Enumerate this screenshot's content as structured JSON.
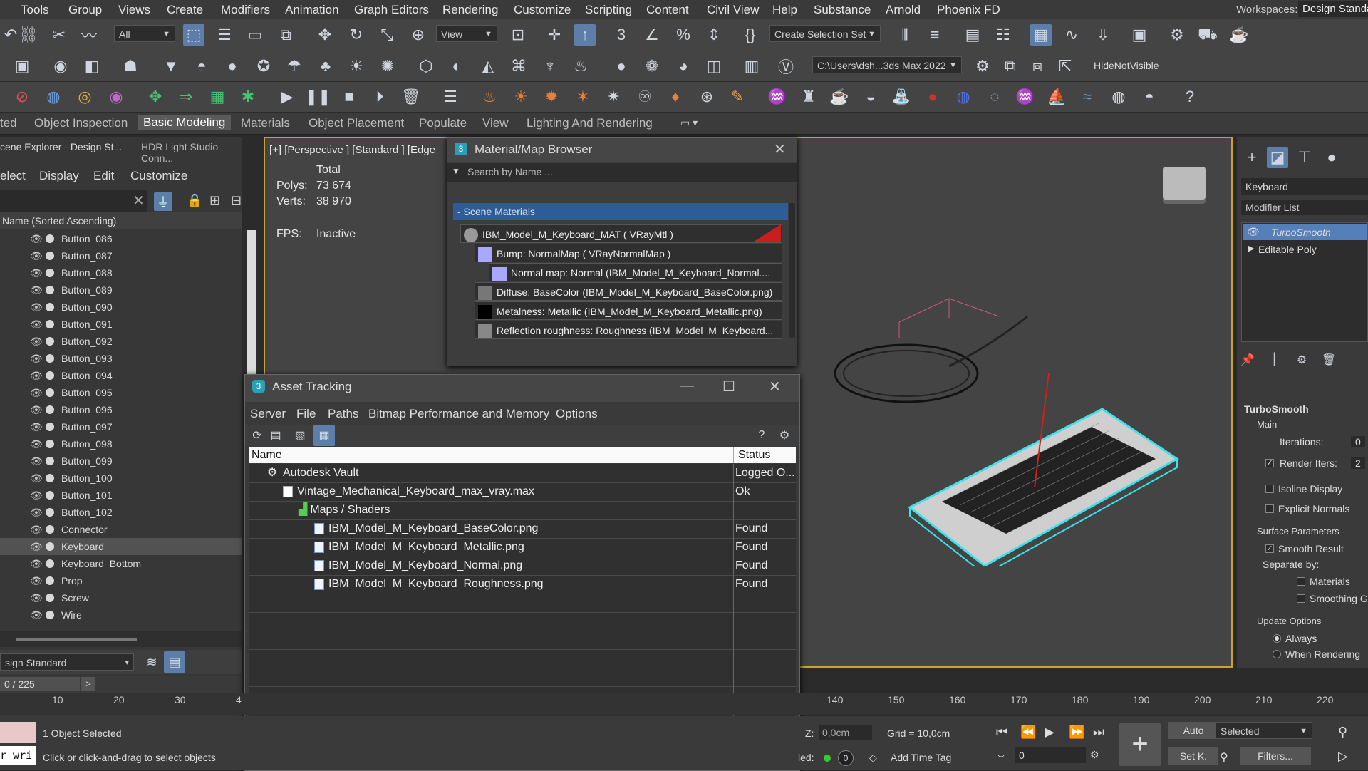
{
  "menu": [
    "Tools",
    "Group",
    "Views",
    "Create",
    "Modifiers",
    "Animation",
    "Graph Editors",
    "Rendering",
    "Customize",
    "Scripting",
    "Content",
    "Civil View",
    "Help",
    "Substance",
    "Arnold",
    "Phoenix FD"
  ],
  "workspace": {
    "label": "Workspaces:",
    "value": "Design Standard"
  },
  "toolbar": {
    "selection_filter": "All",
    "ref_coord": "View",
    "selection_set": "Create Selection Set",
    "project_path": "C:\\Users\\dsh...3ds Max 2022",
    "hide_not_visible": "HideNotVisible"
  },
  "ribbon_tabs": [
    "ted",
    "Object Inspection",
    "Basic Modeling",
    "Materials",
    "Object Placement",
    "Populate",
    "View",
    "Lighting And Rendering"
  ],
  "scene_explorer": {
    "tab1": "cene Explorer - Design St...",
    "tab2": "HDR Light Studio Conn...",
    "menu": [
      "elect",
      "Display",
      "Edit",
      "Customize"
    ],
    "column_header": "Name (Sorted Ascending)",
    "items": [
      "Button_086",
      "Button_087",
      "Button_088",
      "Button_089",
      "Button_090",
      "Button_091",
      "Button_092",
      "Button_093",
      "Button_094",
      "Button_095",
      "Button_096",
      "Button_097",
      "Button_098",
      "Button_099",
      "Button_100",
      "Button_101",
      "Button_102",
      "Connector",
      "Keyboard",
      "Keyboard_Bottom",
      "Prop",
      "Screw",
      "Wire"
    ],
    "selected": "Keyboard",
    "layer_dropdown": "sign Standard",
    "frame_counter": "0 / 225"
  },
  "viewport": {
    "label": "[+] [Perspective ] [Standard ] [Edge",
    "stats_total": "Total",
    "polys_label": "Polys:",
    "polys_value": "73 674",
    "verts_label": "Verts:",
    "verts_value": "38 970",
    "fps_label": "FPS:",
    "fps_value": "Inactive"
  },
  "material_browser": {
    "title": "Material/Map Browser",
    "search_placeholder": "Search by Name ...",
    "group": "- Scene Materials",
    "tree": [
      "IBM_Model_M_Keyboard_MAT  ( VRayMtl )",
      "Bump: NormalMap  ( VRayNormalMap )",
      "Normal map: Normal (IBM_Model_M_Keyboard_Normal....",
      "Diffuse: BaseColor (IBM_Model_M_Keyboard_BaseColor.png)",
      "Metalness: Metallic (IBM_Model_M_Keyboard_Metallic.png)",
      "Reflection  roughness:  Roughness  (IBM_Model_M_Keyboard..."
    ]
  },
  "asset_tracking": {
    "title": "Asset Tracking",
    "menu": [
      "Server",
      "File",
      "Paths",
      "Bitmap Performance and Memory",
      "Options"
    ],
    "columns": {
      "name": "Name",
      "status": "Status"
    },
    "rows": [
      {
        "name": "Autodesk Vault",
        "status": "Logged O..."
      },
      {
        "name": "Vintage_Mechanical_Keyboard_max_vray.max",
        "status": "Ok"
      },
      {
        "name": "Maps / Shaders",
        "status": ""
      },
      {
        "name": "IBM_Model_M_Keyboard_BaseColor.png",
        "status": "Found"
      },
      {
        "name": "IBM_Model_M_Keyboard_Metallic.png",
        "status": "Found"
      },
      {
        "name": "IBM_Model_M_Keyboard_Normal.png",
        "status": "Found"
      },
      {
        "name": "IBM_Model_M_Keyboard_Roughness.png",
        "status": "Found"
      }
    ]
  },
  "command_panel": {
    "object_name": "Keyboard",
    "modifier_list": "Modifier List",
    "stack": [
      "TurboSmooth",
      "Editable Poly"
    ],
    "rollout": "TurboSmooth",
    "main": "Main",
    "iterations_label": "Iterations:",
    "iterations_value": "0",
    "render_iters_label": "Render Iters:",
    "render_iters_value": "2",
    "isoline": "Isoline Display",
    "explicit_normals": "Explicit Normals",
    "surface_params": "Surface Parameters",
    "smooth_result": "Smooth Result",
    "separate_by": "Separate by:",
    "materials": "Materials",
    "smoothing": "Smoothing G",
    "update_options": "Update Options",
    "always": "Always",
    "when_rendering": "When Rendering"
  },
  "timeline": {
    "ticks_left": [
      "10",
      "20",
      "30",
      "4"
    ],
    "ticks_right": [
      "140",
      "150",
      "160",
      "170",
      "180",
      "190",
      "200",
      "210",
      "220"
    ]
  },
  "status": {
    "selected": "1 Object Selected",
    "prompt": "Click or click-and-drag to select objects",
    "maxscript": "r wri",
    "z_label": "Z:",
    "z_value": "0,0cm",
    "grid": "Grid = 10,0cm",
    "auto": "Auto",
    "set_key": "Set K.",
    "key_mode": "Selected",
    "filters": "Filters...",
    "frame": "0",
    "add_time_tag": "Add Time Tag",
    "enabled": "led:"
  }
}
